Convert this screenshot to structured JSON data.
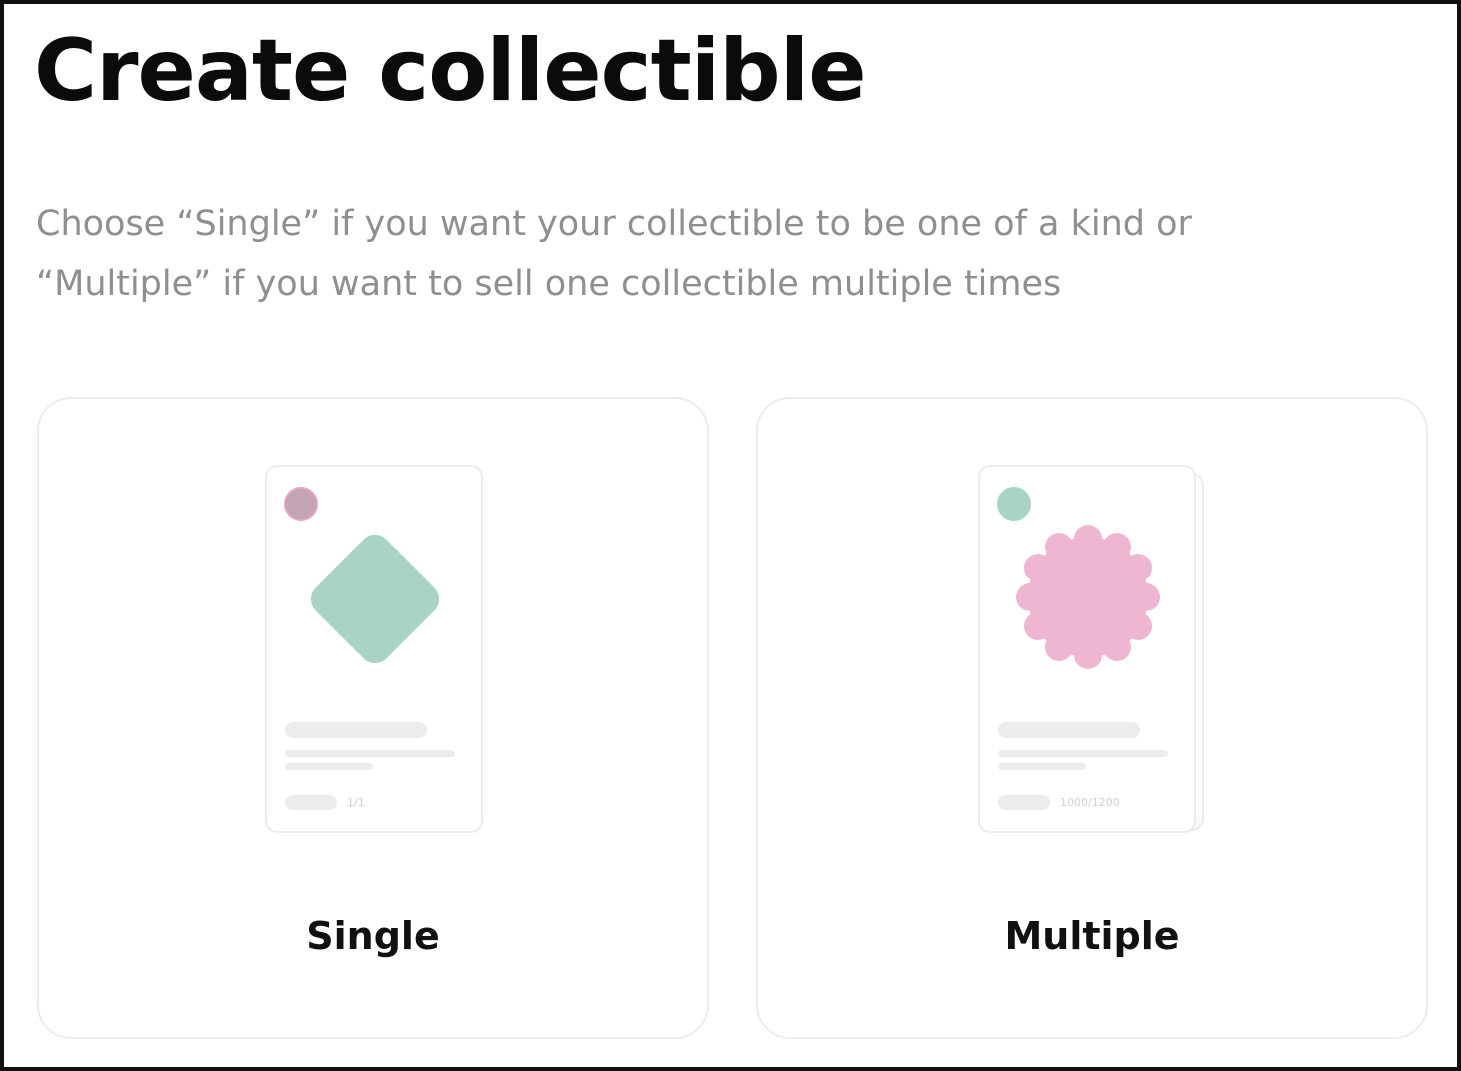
{
  "page": {
    "title": "Create collectible",
    "subtitle": "Choose “Single” if you want your collectible to be one of a kind or “Multiple” if you want to sell one collectible multiple times"
  },
  "options": [
    {
      "label": "Single",
      "edition_text": "1/1",
      "avatar_icon": "avatar-dot",
      "art_icon": "rounded-diamond-icon",
      "colors": {
        "avatar": "#c3a4b4",
        "art": "#a8d3c6"
      }
    },
    {
      "label": "Multiple",
      "edition_text": "1000/1200",
      "avatar_icon": "avatar-dot",
      "art_icon": "scalloped-badge-icon",
      "colors": {
        "avatar": "#a8d3c6",
        "art": "#efb6d2"
      }
    }
  ],
  "colors": {
    "card_border": "#ececec",
    "title": "#0b0b0b",
    "subtitle": "#8f8f8f",
    "skeleton": "#ececec"
  }
}
